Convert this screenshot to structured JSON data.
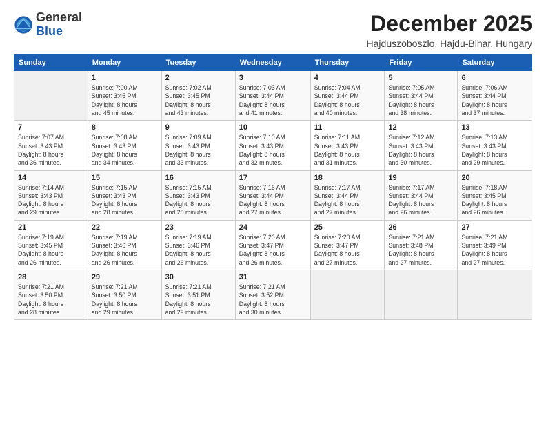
{
  "header": {
    "logo_general": "General",
    "logo_blue": "Blue",
    "month_title": "December 2025",
    "location": "Hajduszoboszlo, Hajdu-Bihar, Hungary"
  },
  "days_of_week": [
    "Sunday",
    "Monday",
    "Tuesday",
    "Wednesday",
    "Thursday",
    "Friday",
    "Saturday"
  ],
  "weeks": [
    [
      {
        "day": "",
        "info": ""
      },
      {
        "day": "1",
        "info": "Sunrise: 7:00 AM\nSunset: 3:45 PM\nDaylight: 8 hours\nand 45 minutes."
      },
      {
        "day": "2",
        "info": "Sunrise: 7:02 AM\nSunset: 3:45 PM\nDaylight: 8 hours\nand 43 minutes."
      },
      {
        "day": "3",
        "info": "Sunrise: 7:03 AM\nSunset: 3:44 PM\nDaylight: 8 hours\nand 41 minutes."
      },
      {
        "day": "4",
        "info": "Sunrise: 7:04 AM\nSunset: 3:44 PM\nDaylight: 8 hours\nand 40 minutes."
      },
      {
        "day": "5",
        "info": "Sunrise: 7:05 AM\nSunset: 3:44 PM\nDaylight: 8 hours\nand 38 minutes."
      },
      {
        "day": "6",
        "info": "Sunrise: 7:06 AM\nSunset: 3:44 PM\nDaylight: 8 hours\nand 37 minutes."
      }
    ],
    [
      {
        "day": "7",
        "info": "Sunrise: 7:07 AM\nSunset: 3:43 PM\nDaylight: 8 hours\nand 36 minutes."
      },
      {
        "day": "8",
        "info": "Sunrise: 7:08 AM\nSunset: 3:43 PM\nDaylight: 8 hours\nand 34 minutes."
      },
      {
        "day": "9",
        "info": "Sunrise: 7:09 AM\nSunset: 3:43 PM\nDaylight: 8 hours\nand 33 minutes."
      },
      {
        "day": "10",
        "info": "Sunrise: 7:10 AM\nSunset: 3:43 PM\nDaylight: 8 hours\nand 32 minutes."
      },
      {
        "day": "11",
        "info": "Sunrise: 7:11 AM\nSunset: 3:43 PM\nDaylight: 8 hours\nand 31 minutes."
      },
      {
        "day": "12",
        "info": "Sunrise: 7:12 AM\nSunset: 3:43 PM\nDaylight: 8 hours\nand 30 minutes."
      },
      {
        "day": "13",
        "info": "Sunrise: 7:13 AM\nSunset: 3:43 PM\nDaylight: 8 hours\nand 29 minutes."
      }
    ],
    [
      {
        "day": "14",
        "info": "Sunrise: 7:14 AM\nSunset: 3:43 PM\nDaylight: 8 hours\nand 29 minutes."
      },
      {
        "day": "15",
        "info": "Sunrise: 7:15 AM\nSunset: 3:43 PM\nDaylight: 8 hours\nand 28 minutes."
      },
      {
        "day": "16",
        "info": "Sunrise: 7:15 AM\nSunset: 3:43 PM\nDaylight: 8 hours\nand 28 minutes."
      },
      {
        "day": "17",
        "info": "Sunrise: 7:16 AM\nSunset: 3:44 PM\nDaylight: 8 hours\nand 27 minutes."
      },
      {
        "day": "18",
        "info": "Sunrise: 7:17 AM\nSunset: 3:44 PM\nDaylight: 8 hours\nand 27 minutes."
      },
      {
        "day": "19",
        "info": "Sunrise: 7:17 AM\nSunset: 3:44 PM\nDaylight: 8 hours\nand 26 minutes."
      },
      {
        "day": "20",
        "info": "Sunrise: 7:18 AM\nSunset: 3:45 PM\nDaylight: 8 hours\nand 26 minutes."
      }
    ],
    [
      {
        "day": "21",
        "info": "Sunrise: 7:19 AM\nSunset: 3:45 PM\nDaylight: 8 hours\nand 26 minutes."
      },
      {
        "day": "22",
        "info": "Sunrise: 7:19 AM\nSunset: 3:46 PM\nDaylight: 8 hours\nand 26 minutes."
      },
      {
        "day": "23",
        "info": "Sunrise: 7:19 AM\nSunset: 3:46 PM\nDaylight: 8 hours\nand 26 minutes."
      },
      {
        "day": "24",
        "info": "Sunrise: 7:20 AM\nSunset: 3:47 PM\nDaylight: 8 hours\nand 26 minutes."
      },
      {
        "day": "25",
        "info": "Sunrise: 7:20 AM\nSunset: 3:47 PM\nDaylight: 8 hours\nand 27 minutes."
      },
      {
        "day": "26",
        "info": "Sunrise: 7:21 AM\nSunset: 3:48 PM\nDaylight: 8 hours\nand 27 minutes."
      },
      {
        "day": "27",
        "info": "Sunrise: 7:21 AM\nSunset: 3:49 PM\nDaylight: 8 hours\nand 27 minutes."
      }
    ],
    [
      {
        "day": "28",
        "info": "Sunrise: 7:21 AM\nSunset: 3:50 PM\nDaylight: 8 hours\nand 28 minutes."
      },
      {
        "day": "29",
        "info": "Sunrise: 7:21 AM\nSunset: 3:50 PM\nDaylight: 8 hours\nand 29 minutes."
      },
      {
        "day": "30",
        "info": "Sunrise: 7:21 AM\nSunset: 3:51 PM\nDaylight: 8 hours\nand 29 minutes."
      },
      {
        "day": "31",
        "info": "Sunrise: 7:21 AM\nSunset: 3:52 PM\nDaylight: 8 hours\nand 30 minutes."
      },
      {
        "day": "",
        "info": ""
      },
      {
        "day": "",
        "info": ""
      },
      {
        "day": "",
        "info": ""
      }
    ]
  ]
}
